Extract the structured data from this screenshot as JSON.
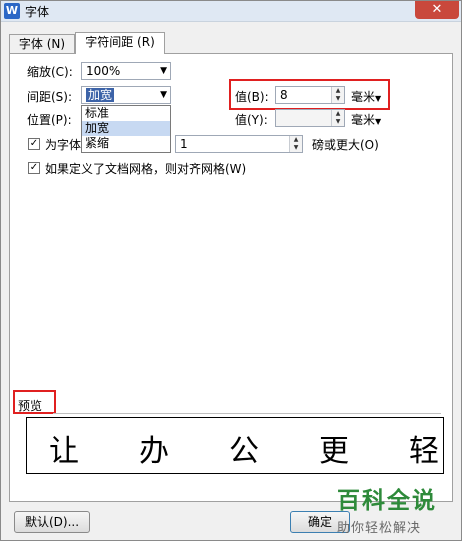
{
  "window": {
    "title": "字体",
    "app_icon": "W",
    "close_glyph": "✕"
  },
  "tabs": [
    {
      "label": "字体 (N)",
      "active": false
    },
    {
      "label": "字符间距 (R)",
      "active": true
    }
  ],
  "scale": {
    "label": "缩放(C):",
    "value": "100%"
  },
  "spacing": {
    "label": "间距(S):",
    "value": "加宽",
    "options": [
      "标准",
      "加宽",
      "紧缩"
    ]
  },
  "spacing_value": {
    "label": "值(B):",
    "value": "8",
    "unit": "毫米"
  },
  "position": {
    "label": "位置(P):"
  },
  "position_value": {
    "label": "值(Y):",
    "value": "",
    "unit": "毫米"
  },
  "kerning": {
    "label_prefix": "为字体",
    "value": "1",
    "label_suffix": "磅或更大(O)",
    "checked": true
  },
  "grid": {
    "label": "如果定义了文档网格，则对齐网格(W)",
    "checked": true
  },
  "preview": {
    "label": "预览",
    "text": "让办公更轻"
  },
  "buttons": {
    "default": "默认(D)...",
    "ok": "确定"
  },
  "watermark": {
    "title": "百科全说",
    "subtitle": "助你轻松解决"
  },
  "accent_colors": {
    "highlight_box": "#e02020",
    "selection": "#3c63a8",
    "watermark": "#2e8a3a"
  }
}
